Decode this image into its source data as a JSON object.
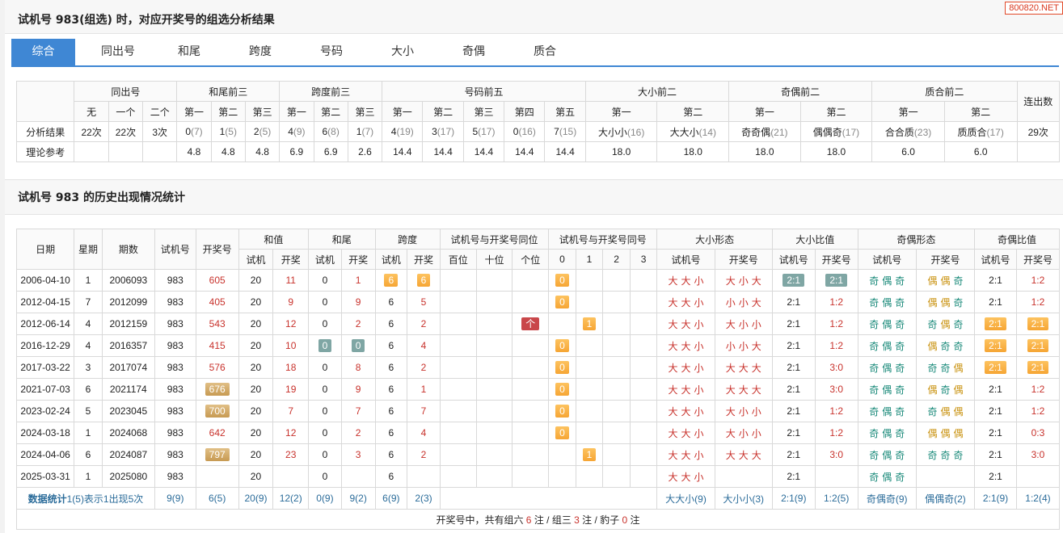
{
  "watermark": "800820.NET",
  "title1": "试机号 983(组选) 时，对应开奖号的组选分析结果",
  "tabs": [
    "综合",
    "同出号",
    "和尾",
    "跨度",
    "号码",
    "大小",
    "奇偶",
    "质合"
  ],
  "t1": {
    "groups": [
      "同出号",
      "和尾前三",
      "跨度前三",
      "号码前五",
      "大小前二",
      "奇偶前二",
      "质合前二",
      "连出数"
    ],
    "sub": [
      "无",
      "一个",
      "二个",
      "第一",
      "第二",
      "第三",
      "第一",
      "第二",
      "第三",
      "第一",
      "第二",
      "第三",
      "第四",
      "第五",
      "第一",
      "第二",
      "第一",
      "第二",
      "第一",
      "第二"
    ],
    "row_label_1": "分析结果",
    "r1": [
      [
        "22次",
        ""
      ],
      [
        "22次",
        ""
      ],
      [
        "3次",
        ""
      ],
      [
        "0",
        "(7)"
      ],
      [
        "1",
        "(5)"
      ],
      [
        "2",
        "(5)"
      ],
      [
        "4",
        "(9)"
      ],
      [
        "6",
        "(8)"
      ],
      [
        "1",
        "(7)"
      ],
      [
        "4",
        "(19)"
      ],
      [
        "3",
        "(17)"
      ],
      [
        "5",
        "(17)"
      ],
      [
        "0",
        "(16)"
      ],
      [
        "7",
        "(15)"
      ],
      [
        "大小小",
        "(16)"
      ],
      [
        "大大小",
        "(14)"
      ],
      [
        "奇奇偶",
        "(21)"
      ],
      [
        "偶偶奇",
        "(17)"
      ],
      [
        "合合质",
        "(23)"
      ],
      [
        "质质合",
        "(17)"
      ]
    ],
    "lianchu": "29次",
    "row_label_2": "理论参考",
    "r2": [
      "",
      "",
      "",
      "4.8",
      "4.8",
      "4.8",
      "6.9",
      "6.9",
      "2.6",
      "14.4",
      "14.4",
      "14.4",
      "14.4",
      "14.4",
      "18.0",
      "18.0",
      "18.0",
      "18.0",
      "6.0",
      "6.0"
    ]
  },
  "title2": "试机号 983 的历史出现情况统计",
  "t2": {
    "h1": {
      "date": "日期",
      "week": "星期",
      "issue": "期数",
      "sjh": "试机号",
      "kjh": "开奖号",
      "hz": "和值",
      "hw": "和尾",
      "kd": "跨度",
      "tw": "试机号与开奖号同位",
      "th": "试机号与开奖号同号",
      "dxxt": "大小形态",
      "dxbz": "大小比值",
      "joxt": "奇偶形态",
      "jobz": "奇偶比值"
    },
    "h2": [
      "试机",
      "开奖",
      "试机",
      "开奖",
      "试机",
      "开奖",
      "百位",
      "十位",
      "个位",
      "0",
      "1",
      "2",
      "3",
      "试机号",
      "开奖号",
      "试机号",
      "开奖号",
      "试机号",
      "开奖号",
      "试机号",
      "开奖号"
    ],
    "rows": [
      {
        "date": "2006-04-10",
        "week": "1",
        "issue": "2006093",
        "sjh": "983",
        "kjh": "605",
        "kjh_hl": "",
        "hz1": "20",
        "hz2": "11",
        "hw1": "0",
        "hw2": "1",
        "hw_hl": "",
        "kd1": "6",
        "kd2": "6",
        "kd_hl": "or",
        "tw": [
          "",
          "",
          ""
        ],
        "th": "0",
        "dx1": [
          "大",
          "大",
          "小"
        ],
        "dx2": [
          "大",
          "小",
          "大"
        ],
        "dxb1": "2:1",
        "dxb2": "2:1",
        "dxb_hl": "gr",
        "jo1": [
          "奇",
          "偶",
          "奇"
        ],
        "jo2": [
          "偶",
          "偶",
          "奇"
        ],
        "job1": "2:1",
        "job2": "1:2",
        "job_hl": ""
      },
      {
        "date": "2012-04-15",
        "week": "7",
        "issue": "2012099",
        "sjh": "983",
        "kjh": "405",
        "kjh_hl": "",
        "hz1": "20",
        "hz2": "9",
        "hw1": "0",
        "hw2": "9",
        "hw_hl": "",
        "kd1": "6",
        "kd2": "5",
        "kd_hl": "",
        "tw": [
          "",
          "",
          ""
        ],
        "th": "0",
        "dx1": [
          "大",
          "大",
          "小"
        ],
        "dx2": [
          "小",
          "小",
          "大"
        ],
        "dxb1": "2:1",
        "dxb2": "1:2",
        "dxb_hl": "",
        "jo1": [
          "奇",
          "偶",
          "奇"
        ],
        "jo2": [
          "偶",
          "偶",
          "奇"
        ],
        "job1": "2:1",
        "job2": "1:2",
        "job_hl": ""
      },
      {
        "date": "2012-06-14",
        "week": "4",
        "issue": "2012159",
        "sjh": "983",
        "kjh": "543",
        "kjh_hl": "",
        "hz1": "20",
        "hz2": "12",
        "hw1": "0",
        "hw2": "2",
        "hw_hl": "",
        "kd1": "6",
        "kd2": "2",
        "kd_hl": "",
        "tw": [
          "",
          "",
          "个"
        ],
        "th": "1",
        "dx1": [
          "大",
          "大",
          "小"
        ],
        "dx2": [
          "大",
          "小",
          "小"
        ],
        "dxb1": "2:1",
        "dxb2": "1:2",
        "dxb_hl": "",
        "jo1": [
          "奇",
          "偶",
          "奇"
        ],
        "jo2": [
          "奇",
          "偶",
          "奇"
        ],
        "job1": "2:1",
        "job2": "2:1",
        "job_hl": "or"
      },
      {
        "date": "2016-12-29",
        "week": "4",
        "issue": "2016357",
        "sjh": "983",
        "kjh": "415",
        "kjh_hl": "",
        "hz1": "20",
        "hz2": "10",
        "hw1": "0",
        "hw2": "0",
        "hw_hl": "gr",
        "kd1": "6",
        "kd2": "4",
        "kd_hl": "",
        "tw": [
          "",
          "",
          ""
        ],
        "th": "0",
        "dx1": [
          "大",
          "大",
          "小"
        ],
        "dx2": [
          "小",
          "小",
          "大"
        ],
        "dxb1": "2:1",
        "dxb2": "1:2",
        "dxb_hl": "",
        "jo1": [
          "奇",
          "偶",
          "奇"
        ],
        "jo2": [
          "偶",
          "奇",
          "奇"
        ],
        "job1": "2:1",
        "job2": "2:1",
        "job_hl": "or"
      },
      {
        "date": "2017-03-22",
        "week": "3",
        "issue": "2017074",
        "sjh": "983",
        "kjh": "576",
        "kjh_hl": "",
        "hz1": "20",
        "hz2": "18",
        "hw1": "0",
        "hw2": "8",
        "hw_hl": "",
        "kd1": "6",
        "kd2": "2",
        "kd_hl": "",
        "tw": [
          "",
          "",
          ""
        ],
        "th": "0",
        "dx1": [
          "大",
          "大",
          "小"
        ],
        "dx2": [
          "大",
          "大",
          "大"
        ],
        "dxb1": "2:1",
        "dxb2": "3:0",
        "dxb_hl": "",
        "jo1": [
          "奇",
          "偶",
          "奇"
        ],
        "jo2": [
          "奇",
          "奇",
          "偶"
        ],
        "job1": "2:1",
        "job2": "2:1",
        "job_hl": "or"
      },
      {
        "date": "2021-07-03",
        "week": "6",
        "issue": "2021174",
        "sjh": "983",
        "kjh": "676",
        "kjh_hl": "tn",
        "hz1": "20",
        "hz2": "19",
        "hw1": "0",
        "hw2": "9",
        "hw_hl": "",
        "kd1": "6",
        "kd2": "1",
        "kd_hl": "",
        "tw": [
          "",
          "",
          ""
        ],
        "th": "0",
        "dx1": [
          "大",
          "大",
          "小"
        ],
        "dx2": [
          "大",
          "大",
          "大"
        ],
        "dxb1": "2:1",
        "dxb2": "3:0",
        "dxb_hl": "",
        "jo1": [
          "奇",
          "偶",
          "奇"
        ],
        "jo2": [
          "偶",
          "奇",
          "偶"
        ],
        "job1": "2:1",
        "job2": "1:2",
        "job_hl": ""
      },
      {
        "date": "2023-02-24",
        "week": "5",
        "issue": "2023045",
        "sjh": "983",
        "kjh": "700",
        "kjh_hl": "tn",
        "hz1": "20",
        "hz2": "7",
        "hw1": "0",
        "hw2": "7",
        "hw_hl": "",
        "kd1": "6",
        "kd2": "7",
        "kd_hl": "",
        "tw": [
          "",
          "",
          ""
        ],
        "th": "0",
        "dx1": [
          "大",
          "大",
          "小"
        ],
        "dx2": [
          "大",
          "小",
          "小"
        ],
        "dxb1": "2:1",
        "dxb2": "1:2",
        "dxb_hl": "",
        "jo1": [
          "奇",
          "偶",
          "奇"
        ],
        "jo2": [
          "奇",
          "偶",
          "偶"
        ],
        "job1": "2:1",
        "job2": "1:2",
        "job_hl": ""
      },
      {
        "date": "2024-03-18",
        "week": "1",
        "issue": "2024068",
        "sjh": "983",
        "kjh": "642",
        "kjh_hl": "",
        "hz1": "20",
        "hz2": "12",
        "hw1": "0",
        "hw2": "2",
        "hw_hl": "",
        "kd1": "6",
        "kd2": "4",
        "kd_hl": "",
        "tw": [
          "",
          "",
          ""
        ],
        "th": "0",
        "dx1": [
          "大",
          "大",
          "小"
        ],
        "dx2": [
          "大",
          "小",
          "小"
        ],
        "dxb1": "2:1",
        "dxb2": "1:2",
        "dxb_hl": "",
        "jo1": [
          "奇",
          "偶",
          "奇"
        ],
        "jo2": [
          "偶",
          "偶",
          "偶"
        ],
        "job1": "2:1",
        "job2": "0:3",
        "job_hl": ""
      },
      {
        "date": "2024-04-06",
        "week": "6",
        "issue": "2024087",
        "sjh": "983",
        "kjh": "797",
        "kjh_hl": "tn",
        "hz1": "20",
        "hz2": "23",
        "hw1": "0",
        "hw2": "3",
        "hw_hl": "",
        "kd1": "6",
        "kd2": "2",
        "kd_hl": "",
        "tw": [
          "",
          "",
          ""
        ],
        "th": "1",
        "dx1": [
          "大",
          "大",
          "小"
        ],
        "dx2": [
          "大",
          "大",
          "大"
        ],
        "dxb1": "2:1",
        "dxb2": "3:0",
        "dxb_hl": "",
        "jo1": [
          "奇",
          "偶",
          "奇"
        ],
        "jo2": [
          "奇",
          "奇",
          "奇"
        ],
        "job1": "2:1",
        "job2": "3:0",
        "job_hl": ""
      },
      {
        "date": "2025-03-31",
        "week": "1",
        "issue": "2025080",
        "sjh": "983",
        "kjh": "",
        "kjh_hl": "",
        "hz1": "20",
        "hz2": "",
        "hw1": "0",
        "hw2": "",
        "hw_hl": "",
        "kd1": "6",
        "kd2": "",
        "kd_hl": "",
        "tw": [
          "",
          "",
          ""
        ],
        "th": "",
        "dx1": [
          "大",
          "大",
          "小"
        ],
        "dx2": [
          "",
          "",
          ""
        ],
        "dxb1": "2:1",
        "dxb2": "",
        "dxb_hl": "",
        "jo1": [
          "奇",
          "偶",
          "奇"
        ],
        "jo2": [
          "",
          "",
          ""
        ],
        "job1": "2:1",
        "job2": "",
        "job_hl": ""
      }
    ],
    "stat": {
      "label": "数据统计",
      "note": "1(5)表示1出现5次",
      "sjh": "9(9)",
      "kjh": "6(5)",
      "hz1": "20(9)",
      "hz2": "12(2)",
      "hw1": "0(9)",
      "hw2": "9(2)",
      "kd1": "6(9)",
      "kd2": "2(3)",
      "dx1": "大大小(9)",
      "dx2": "大小小(3)",
      "dxb1": "2:1(9)",
      "dxb2": "1:2(5)",
      "jo1": "奇偶奇(9)",
      "jo2": "偶偶奇(2)",
      "job1": "2:1(9)",
      "job2": "1:2(4)"
    },
    "footer": {
      "a": "开奖号中，共有组六 ",
      "n1": "6",
      "b": " 注 / 组三 ",
      "n2": "3",
      "c": " 注 / 豹子 ",
      "n3": "0",
      "d": " 注"
    }
  }
}
